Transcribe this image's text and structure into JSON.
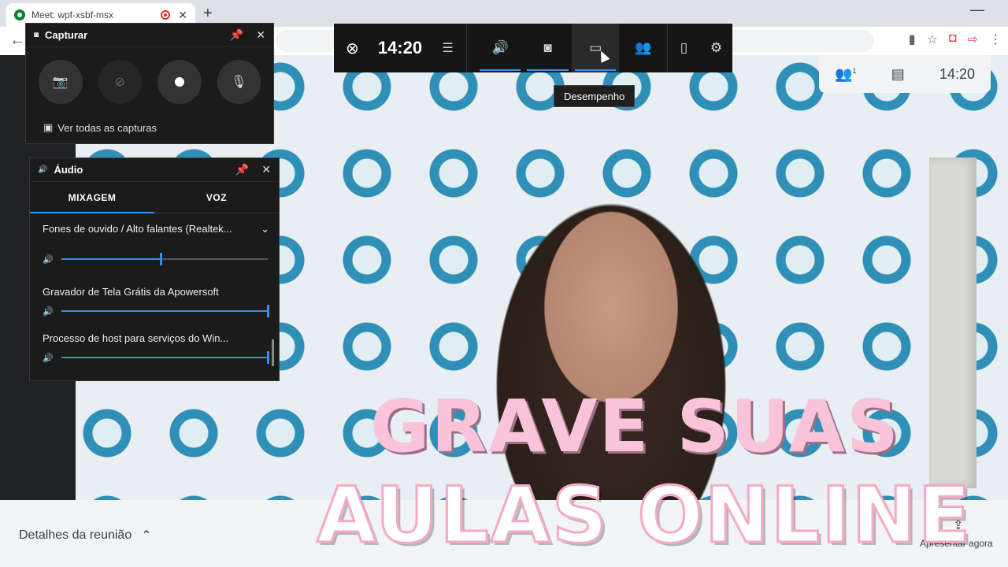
{
  "browser": {
    "tab_title": "Meet: wpf-xsbf-msx",
    "tab_close": "✕",
    "new_tab": "+",
    "back": "←",
    "minimize": "—"
  },
  "gamebar": {
    "time": "14:20",
    "tooltip": "Desempenho"
  },
  "capture_widget": {
    "title": "Capturar",
    "link": "Ver todas as capturas"
  },
  "audio_widget": {
    "title": "Áudio",
    "tabs": [
      {
        "label": "MIXAGEM",
        "active": true
      },
      {
        "label": "VOZ",
        "active": false
      }
    ],
    "device": "Fones de ouvido / Alto falantes (Realtek...",
    "device_volume": 0.48,
    "apps": [
      {
        "name": "Gravador de Tela Grátis da Apowersoft",
        "volume": 1.0
      },
      {
        "name": "Processo de host para serviços do Win...",
        "volume": 1.0
      }
    ]
  },
  "meet": {
    "clock": "14:20",
    "participants_badge": "1",
    "details": "Detalhes da reunião",
    "present": "Apresentar agora"
  },
  "overlay": {
    "line1": "GRAVE SUAS",
    "line2": "AULAS ONLINE"
  },
  "colors": {
    "accent": "#3a8ee6",
    "overlay_pink": "#f9c3da"
  },
  "icons": [
    "meet-icon",
    "record-icon",
    "close-icon",
    "plus-icon",
    "back-arrow-icon",
    "camera-icon",
    "star-icon",
    "pocket-icon",
    "xbox-icon",
    "menu-icon",
    "speaker-icon",
    "capture-icon",
    "performance-icon",
    "people-icon",
    "mouse-icon",
    "gear-icon",
    "pin-icon",
    "screenshot-icon",
    "record-last-icon",
    "mic-icon",
    "gallery-icon",
    "chevron-down-icon",
    "chat-icon",
    "chevron-up-icon",
    "present-icon"
  ]
}
